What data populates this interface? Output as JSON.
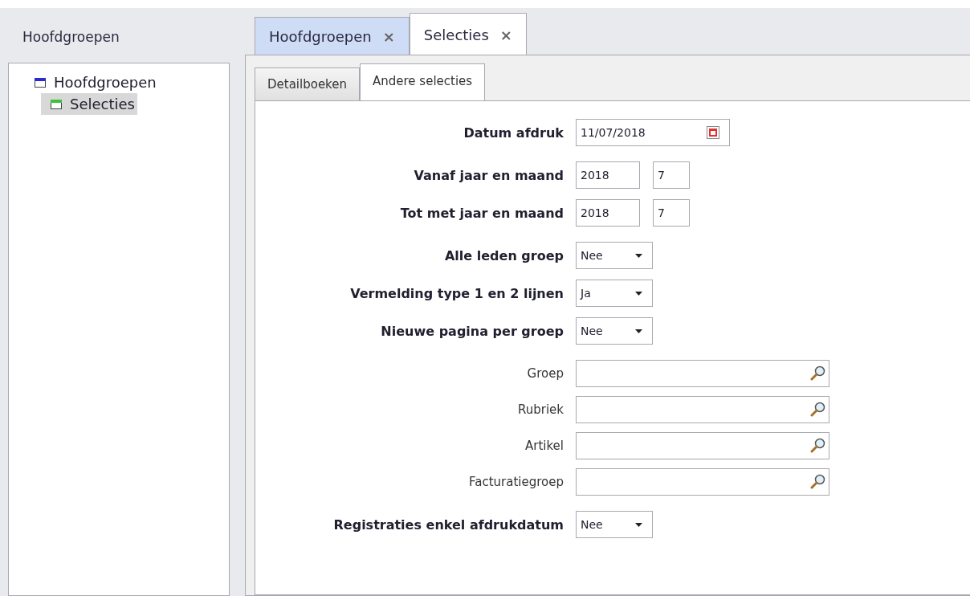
{
  "sidebar": {
    "title": "Hoofdgroepen",
    "tree": [
      {
        "label": "Hoofdgroepen",
        "selected": false,
        "color": "#2b2bd0",
        "children": [
          {
            "label": "Selecties",
            "selected": true,
            "color": "#3cc23c"
          }
        ]
      }
    ]
  },
  "tabs": [
    {
      "label": "Hoofdgroepen",
      "close": "×",
      "selected": false
    },
    {
      "label": "Selecties",
      "close": "×",
      "selected": true
    }
  ],
  "subtabs": [
    {
      "label": "Detailboeken",
      "selected": false
    },
    {
      "label": "Andere selecties",
      "selected": true
    }
  ],
  "form": [
    [
      {
        "kind": "date",
        "label": "Datum afdruk",
        "value": "11/07/2018"
      }
    ],
    [
      {
        "kind": "year_month",
        "label": "Vanaf jaar en maand",
        "year": "2018",
        "month": "7"
      },
      {
        "kind": "year_month",
        "label": "Tot met jaar en maand",
        "year": "2018",
        "month": "7"
      }
    ],
    [
      {
        "kind": "select",
        "label": "Alle leden groep",
        "value": "Nee"
      },
      {
        "kind": "select",
        "label": "Vermelding type 1 en 2 lijnen",
        "value": "Ja"
      },
      {
        "kind": "select",
        "label": "Nieuwe pagina per groep",
        "value": "Nee"
      }
    ],
    [
      {
        "kind": "lookup",
        "label": "Groep"
      },
      {
        "kind": "lookup",
        "label": "Rubriek"
      },
      {
        "kind": "lookup",
        "label": "Artikel"
      },
      {
        "kind": "lookup",
        "label": "Facturatiegroep"
      }
    ],
    [
      {
        "kind": "select",
        "label": "Registraties enkel afdrukdatum",
        "value": "Nee"
      }
    ]
  ]
}
